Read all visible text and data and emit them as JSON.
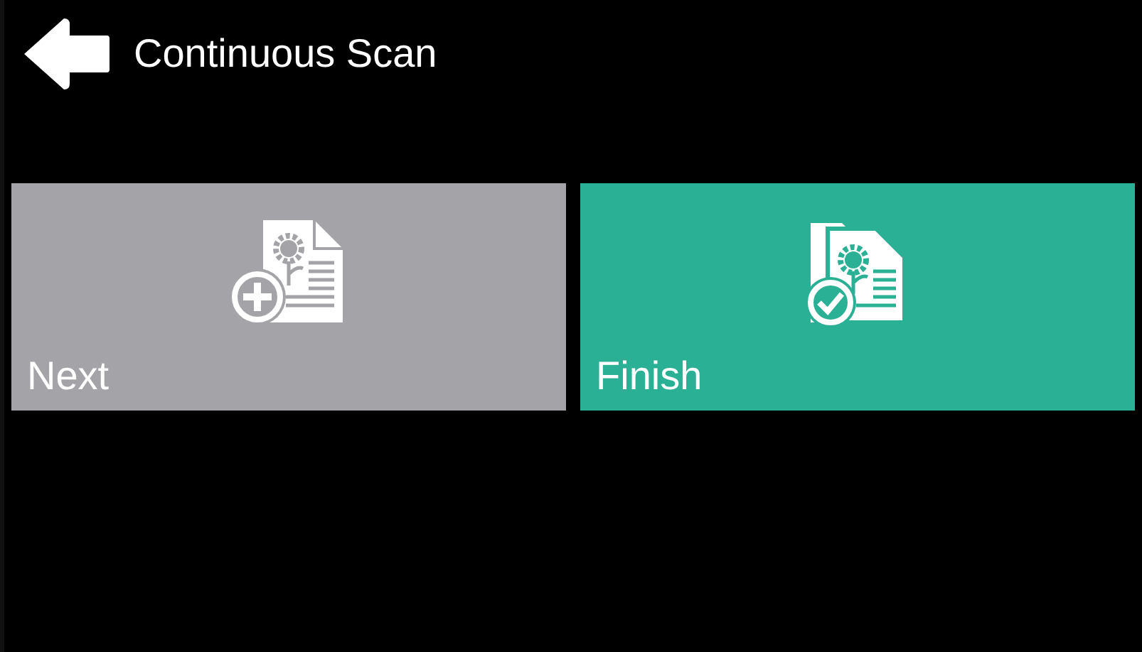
{
  "header": {
    "title": "Continuous Scan"
  },
  "tiles": [
    {
      "label": "Next",
      "kind": "add",
      "color": "#a4a3a7"
    },
    {
      "label": "Finish",
      "kind": "finish",
      "color": "#2ab094"
    }
  ]
}
